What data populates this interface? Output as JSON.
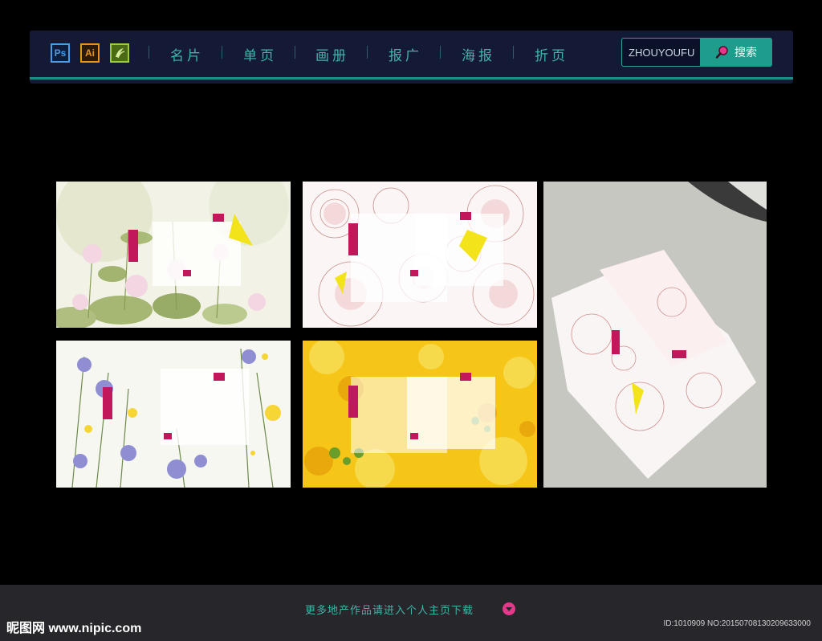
{
  "nav": {
    "tools": [
      "Ps",
      "Ai",
      "Id"
    ],
    "items": [
      "名片",
      "单页",
      "画册",
      "报广",
      "海报",
      "折页"
    ],
    "search": {
      "value": "ZHOUYOUFU",
      "button_label": "搜索"
    }
  },
  "footer": {
    "more_link": "更多地产作品请进入个人主页下载",
    "watermark": "昵图网 www.nipic.com",
    "image_id": "ID:1010909 NO:20150708130209633000"
  },
  "colors": {
    "accent": "#1e9d8d",
    "nav_bg": "#141a35",
    "pink": "#e5388a"
  }
}
